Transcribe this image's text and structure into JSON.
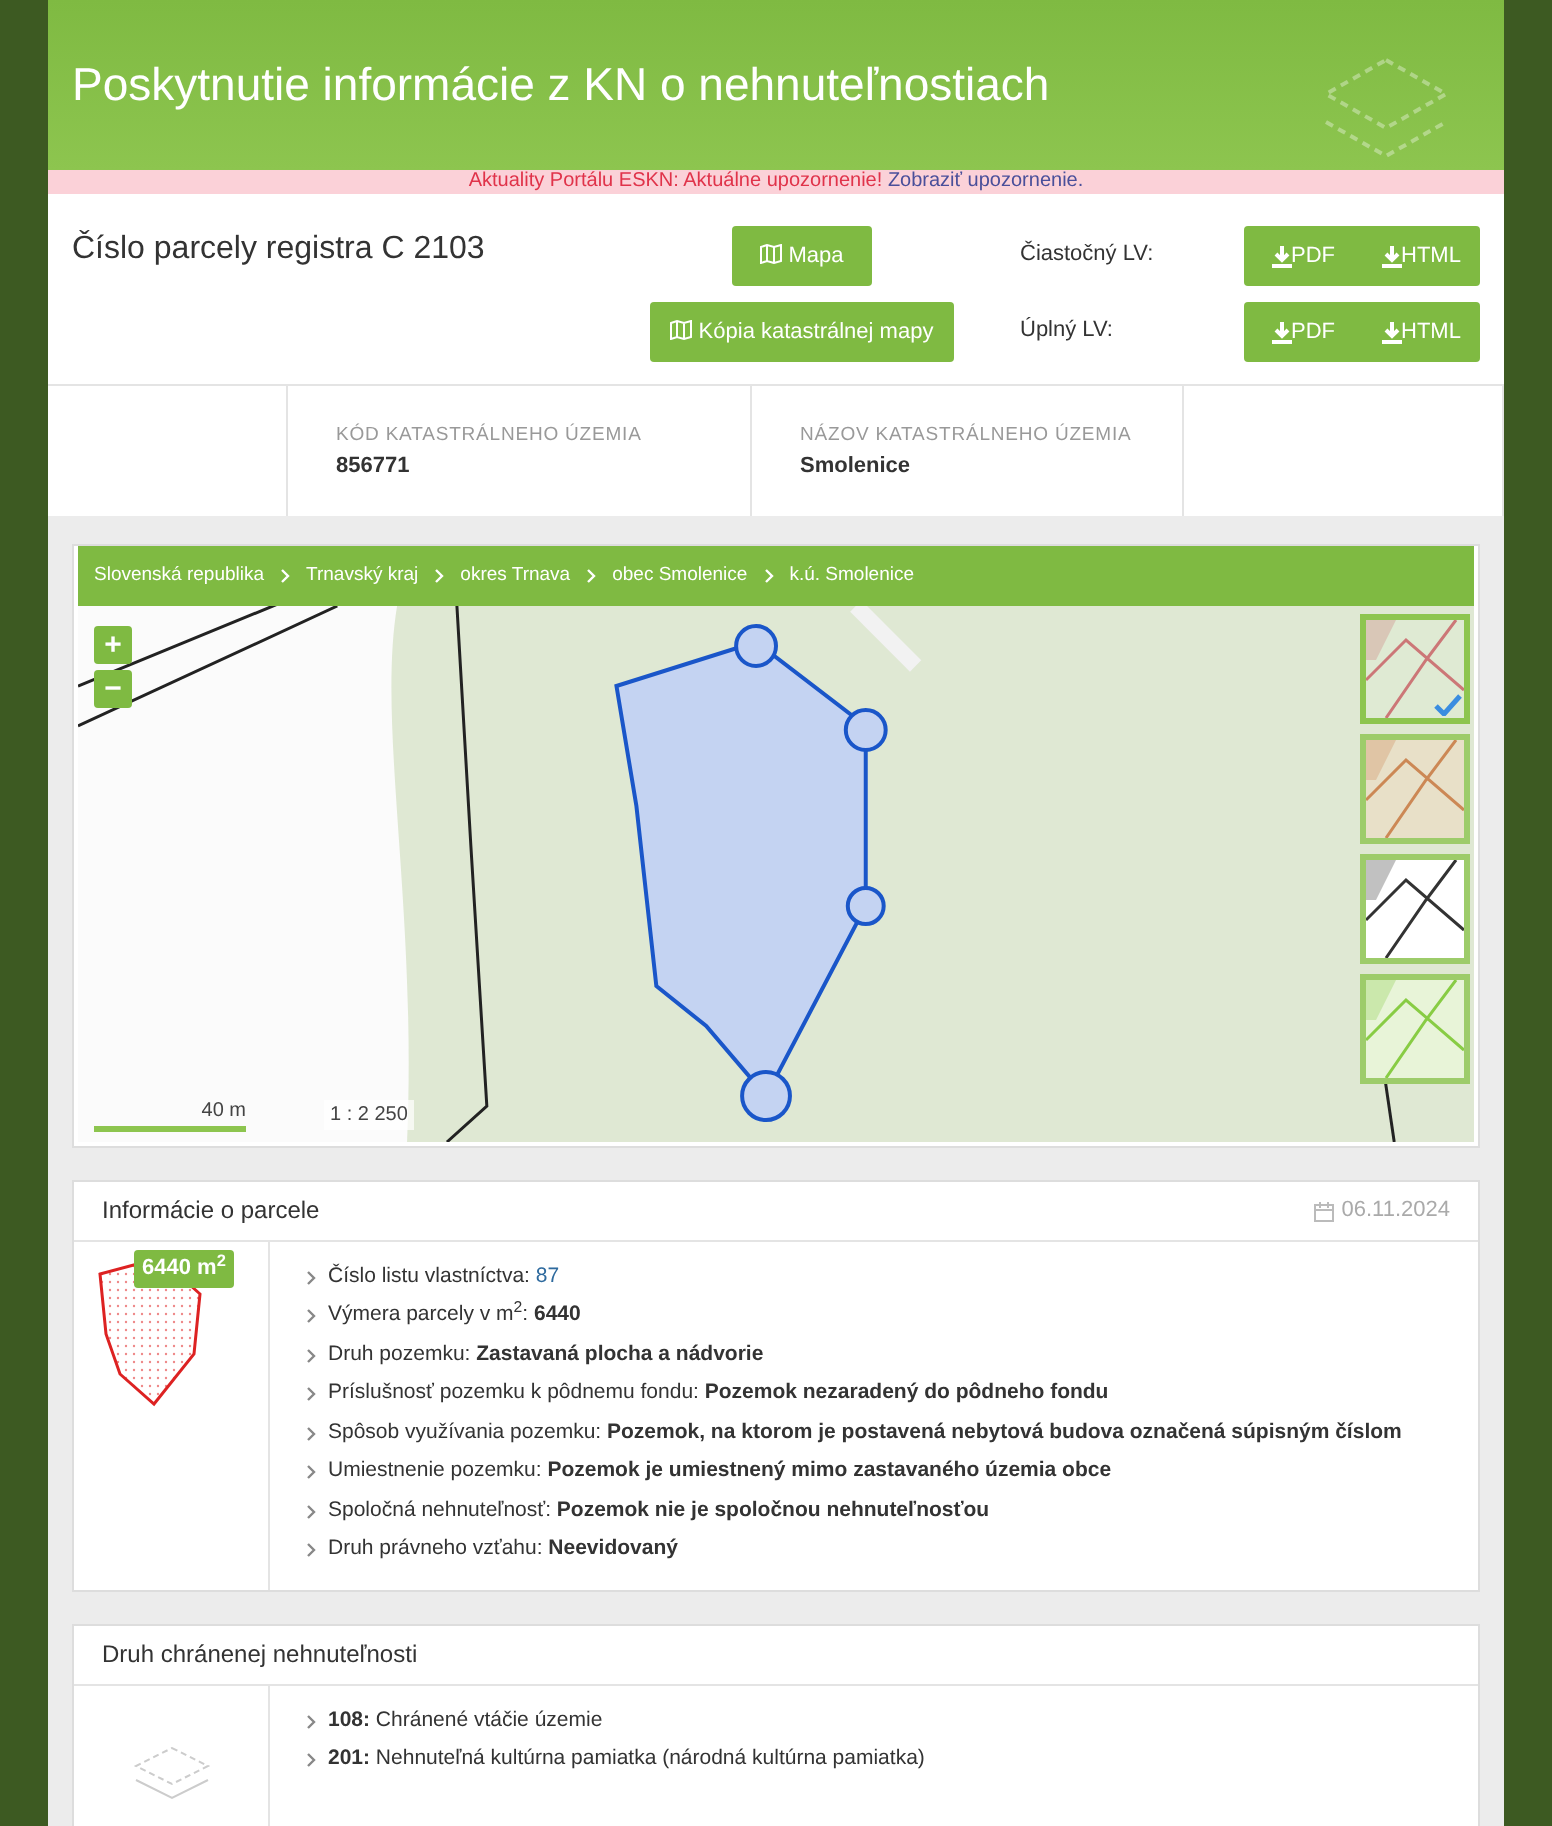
{
  "header": {
    "title": "Poskytnutie informácie z KN o nehnuteľnostiach"
  },
  "notice": {
    "text": "Aktuality Portálu ESKN: Aktuálne upozornenie!",
    "link": "Zobraziť upozornenie."
  },
  "parcel": {
    "title": "Číslo parcely registra C 2103",
    "map_buttons": [
      "Mapa",
      "Kópia katastrálnej mapy"
    ],
    "lv": [
      {
        "label": "Čiastočný LV:",
        "buttons": [
          "PDF",
          "HTML"
        ]
      },
      {
        "label": "Úplný LV:",
        "buttons": [
          "PDF",
          "HTML"
        ]
      }
    ]
  },
  "territory": [
    {
      "label": "KÓD KATASTRÁLNEHO ÚZEMIA",
      "value": "856771"
    },
    {
      "label": "NÁZOV KATASTRÁLNEHO ÚZEMIA",
      "value": "Smolenice"
    }
  ],
  "map": {
    "breadcrumb": [
      "Slovenská republika",
      "Trnavský kraj",
      "okres Trnava",
      "obec Smolenice",
      "k.ú. Smolenice"
    ],
    "zoom": [
      "+",
      "−"
    ],
    "scale": "40 m",
    "ratio": "1 : 2 250",
    "layers": [
      {
        "selected": true
      },
      {
        "selected": false
      },
      {
        "selected": false
      },
      {
        "selected": false
      }
    ]
  },
  "info": {
    "title": "Informácie o parcele",
    "date": "06.11.2024",
    "area_badge": "6440 m$^{2}$",
    "items": [
      {
        "label": "Číslo listu vlastníctva:",
        "value": "87",
        "kind": "link"
      },
      {
        "label": "Výmera parcely v m$^{2}$:",
        "value": "6440",
        "kind": "bold"
      },
      {
        "label": "Druh pozemku:",
        "value": "Zastavaná plocha a nádvorie",
        "kind": "bold"
      },
      {
        "label": "Príslušnosť pozemku k pôdnemu fondu:",
        "value": "Pozemok nezaradený do pôdneho fondu",
        "kind": "bold"
      },
      {
        "label": "Spôsob využívania pozemku:",
        "value": "Pozemok, na ktorom je postavená nebytová budova označená súpisným číslom",
        "kind": "bold"
      },
      {
        "label": "Umiestnenie pozemku:",
        "value": "Pozemok je umiestnený mimo zastavaného územia obce",
        "kind": "bold"
      },
      {
        "label": "Spoločná nehnuteľnosť:",
        "value": "Pozemok nie je spoločnou nehnuteľnosťou",
        "kind": "bold"
      },
      {
        "label": "Druh právneho vzťahu:",
        "value": "Neevidovaný",
        "kind": "bold"
      }
    ]
  },
  "protected": {
    "title": "Druh chránenej nehnuteľnosti",
    "items": [
      "**108:** Chránené vtáčie územie",
      "**201:** Nehnuteľná kultúrna pamiatka (národná kultúrna pamiatka)"
    ]
  }
}
